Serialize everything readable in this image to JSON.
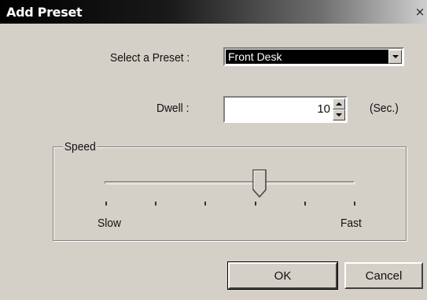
{
  "window": {
    "title": "Add Preset",
    "close_glyph": "×"
  },
  "preset": {
    "label": "Select a Preset :",
    "value": "Front Desk"
  },
  "dwell": {
    "label": "Dwell :",
    "value": "10",
    "unit": "(Sec.)"
  },
  "speed": {
    "group_title": "Speed",
    "min_label": "Slow",
    "max_label": "Fast",
    "tick_count": 6,
    "value_fraction": 0.62
  },
  "buttons": {
    "ok": "OK",
    "cancel": "Cancel"
  },
  "colors": {
    "face": "#d4d0c8",
    "selection": "#000000"
  }
}
